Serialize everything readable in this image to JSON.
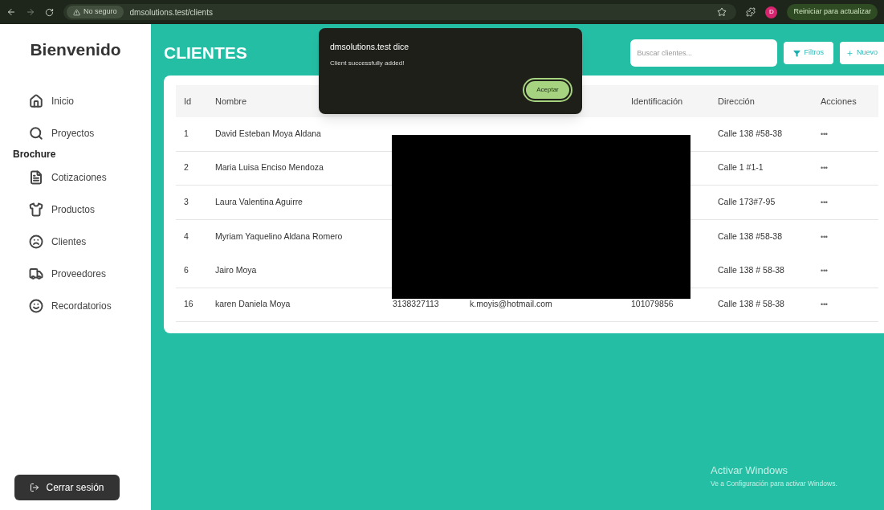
{
  "browser": {
    "security": "No seguro",
    "url": "dmsolutions.test/clients",
    "update_button": "Reiniciar para actualizar",
    "profile_initial": "D"
  },
  "sidebar": {
    "title": "Bienvenido",
    "items": [
      {
        "label": "Inicio",
        "kind": "link"
      },
      {
        "label": "Proyectos",
        "kind": "link"
      },
      {
        "label": "Brochure",
        "kind": "section"
      },
      {
        "label": "Cotizaciones",
        "kind": "link"
      },
      {
        "label": "Productos",
        "kind": "link"
      },
      {
        "label": "Clientes",
        "kind": "link"
      },
      {
        "label": "Proveedores",
        "kind": "link"
      },
      {
        "label": "Recordatorios",
        "kind": "link"
      }
    ],
    "logout": "Cerrar sesión"
  },
  "page": {
    "title": "CLIENTES",
    "search": {
      "placeholder": "Buscar clientes..."
    },
    "filter_button": "Filtros",
    "new_button": "Nuevo"
  },
  "table": {
    "columns": [
      "Id",
      "Nombre",
      null,
      null,
      "Identificación",
      "Dirección",
      "Acciones"
    ],
    "rows": [
      {
        "id": "1",
        "name": "David Esteban Moya Aldana",
        "address": "Calle 138 #58-38",
        "actions": "•••"
      },
      {
        "id": "2",
        "name": "Maria Luisa Enciso Mendoza",
        "address": "Calle 1 #1-1",
        "actions": "•••"
      },
      {
        "id": "3",
        "name": "Laura Valentina Aguirre",
        "address": "Calle 173#7-95",
        "actions": "•••"
      },
      {
        "id": "4",
        "name": "Myriam Yaquelino Aldana Romero",
        "address": "Calle 138 #58-38",
        "actions": "•••"
      },
      {
        "id": "6",
        "name": "Jairo Moya",
        "address": "Calle 138 # 58-38",
        "actions": "•••"
      },
      {
        "id": "16",
        "name": "karen Daniela Moya",
        "phone": "3138327113",
        "email": "k.moyis@hotmail.com",
        "identification": "101079856",
        "address": "Calle 138 # 58-38",
        "actions": "•••"
      }
    ]
  },
  "dialog": {
    "title": "dmsolutions.test dice",
    "message": "Client successfully added!",
    "button": "Aceptar"
  },
  "os_notice": {
    "title": "Activar Windows",
    "message": "Ve a Configuración para activar Windows."
  }
}
